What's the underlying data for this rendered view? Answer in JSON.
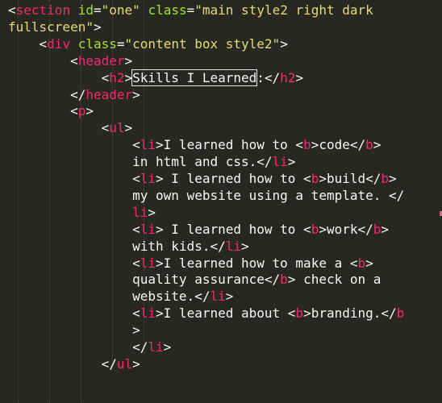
{
  "editor": {
    "language": "html",
    "theme_colors": {
      "background": "#272822",
      "text": "#f8f8f2",
      "tag": "#f92672",
      "attribute": "#a6e22e",
      "string": "#e6db74"
    },
    "lines": [
      {
        "tokens": [
          [
            "p",
            "<"
          ],
          [
            "t",
            "section"
          ],
          [
            "x",
            " "
          ],
          [
            "a",
            "id"
          ],
          [
            "p",
            "="
          ],
          [
            "s",
            "\"one\""
          ],
          [
            "x",
            " "
          ],
          [
            "a",
            "class"
          ],
          [
            "p",
            "="
          ],
          [
            "s",
            "\"main style2 right dark"
          ]
        ]
      },
      {
        "tokens": [
          [
            "s",
            "fullscreen\""
          ],
          [
            "p",
            ">"
          ]
        ]
      },
      {
        "tokens": [
          [
            "x",
            "    "
          ],
          [
            "p",
            "<"
          ],
          [
            "t",
            "div"
          ],
          [
            "x",
            " "
          ],
          [
            "a",
            "class"
          ],
          [
            "p",
            "="
          ],
          [
            "s",
            "\"content box style2\""
          ],
          [
            "p",
            ">"
          ]
        ]
      },
      {
        "tokens": [
          [
            "x",
            "        "
          ],
          [
            "p",
            "<"
          ],
          [
            "t",
            "header"
          ],
          [
            "p",
            ">"
          ]
        ]
      },
      {
        "tokens": [
          [
            "x",
            "            "
          ],
          [
            "p",
            "<"
          ],
          [
            "t",
            "h2"
          ],
          [
            "p",
            ">"
          ],
          [
            "sel",
            "Skills I Learned"
          ],
          [
            "p",
            ":</"
          ],
          [
            "t",
            "h2"
          ],
          [
            "p",
            ">"
          ]
        ]
      },
      {
        "tokens": [
          [
            "x",
            "        "
          ],
          [
            "p",
            "</"
          ],
          [
            "t",
            "header"
          ],
          [
            "p",
            ">"
          ]
        ]
      },
      {
        "tokens": [
          [
            "x",
            "        "
          ],
          [
            "p",
            "<"
          ],
          [
            "t",
            "p"
          ],
          [
            "p",
            ">"
          ]
        ]
      },
      {
        "tokens": [
          [
            "x",
            "            "
          ],
          [
            "p",
            "<"
          ],
          [
            "t",
            "ul"
          ],
          [
            "p",
            ">"
          ]
        ]
      },
      {
        "tokens": [
          [
            "x",
            "                "
          ],
          [
            "p",
            "<"
          ],
          [
            "t",
            "li"
          ],
          [
            "p",
            ">I learned how to <"
          ],
          [
            "t",
            "b"
          ],
          [
            "p",
            ">code</"
          ],
          [
            "t",
            "b"
          ],
          [
            "p",
            ">"
          ]
        ]
      },
      {
        "tokens": [
          [
            "x",
            "                in html and css.</"
          ],
          [
            "t",
            "li"
          ],
          [
            "p",
            ">"
          ]
        ]
      },
      {
        "tokens": [
          [
            "x",
            "                "
          ],
          [
            "p",
            "<"
          ],
          [
            "t",
            "li"
          ],
          [
            "p",
            "> I learned how to <"
          ],
          [
            "t",
            "b"
          ],
          [
            "p",
            ">build</"
          ],
          [
            "t",
            "b"
          ],
          [
            "p",
            ">"
          ]
        ]
      },
      {
        "tokens": [
          [
            "x",
            "                my own website using a template. </"
          ]
        ]
      },
      {
        "tokens": [
          [
            "x",
            "                "
          ],
          [
            "t",
            "li"
          ],
          [
            "p",
            ">"
          ]
        ]
      },
      {
        "tokens": [
          [
            "x",
            "                "
          ],
          [
            "p",
            "<"
          ],
          [
            "t",
            "li"
          ],
          [
            "p",
            "> I learned how to <"
          ],
          [
            "t",
            "b"
          ],
          [
            "p",
            ">work</"
          ],
          [
            "t",
            "b"
          ],
          [
            "p",
            ">"
          ]
        ]
      },
      {
        "tokens": [
          [
            "x",
            "                with kids.</"
          ],
          [
            "t",
            "li"
          ],
          [
            "p",
            ">"
          ]
        ]
      },
      {
        "tokens": [
          [
            "x",
            "                "
          ],
          [
            "p",
            "<"
          ],
          [
            "t",
            "li"
          ],
          [
            "p",
            ">I learned how to make a <"
          ],
          [
            "t",
            "b"
          ],
          [
            "p",
            ">"
          ]
        ]
      },
      {
        "tokens": [
          [
            "x",
            "                quality assurance</"
          ],
          [
            "t",
            "b"
          ],
          [
            "p",
            "> check on a"
          ]
        ]
      },
      {
        "tokens": [
          [
            "x",
            "                website.</"
          ],
          [
            "t",
            "li"
          ],
          [
            "p",
            ">"
          ]
        ]
      },
      {
        "tokens": [
          [
            "x",
            "                "
          ],
          [
            "p",
            "<"
          ],
          [
            "t",
            "li"
          ],
          [
            "p",
            ">I learned about <"
          ],
          [
            "t",
            "b"
          ],
          [
            "p",
            ">branding.</"
          ],
          [
            "t",
            "b"
          ]
        ]
      },
      {
        "tokens": [
          [
            "x",
            "                >"
          ]
        ]
      },
      {
        "tokens": [
          [
            "x",
            "                "
          ],
          [
            "p",
            "</"
          ],
          [
            "t",
            "li"
          ],
          [
            "p",
            ">"
          ]
        ]
      },
      {
        "tokens": [
          [
            "x",
            "            "
          ],
          [
            "p",
            "</"
          ],
          [
            "t",
            "ul"
          ],
          [
            "p",
            ">"
          ]
        ]
      }
    ]
  }
}
